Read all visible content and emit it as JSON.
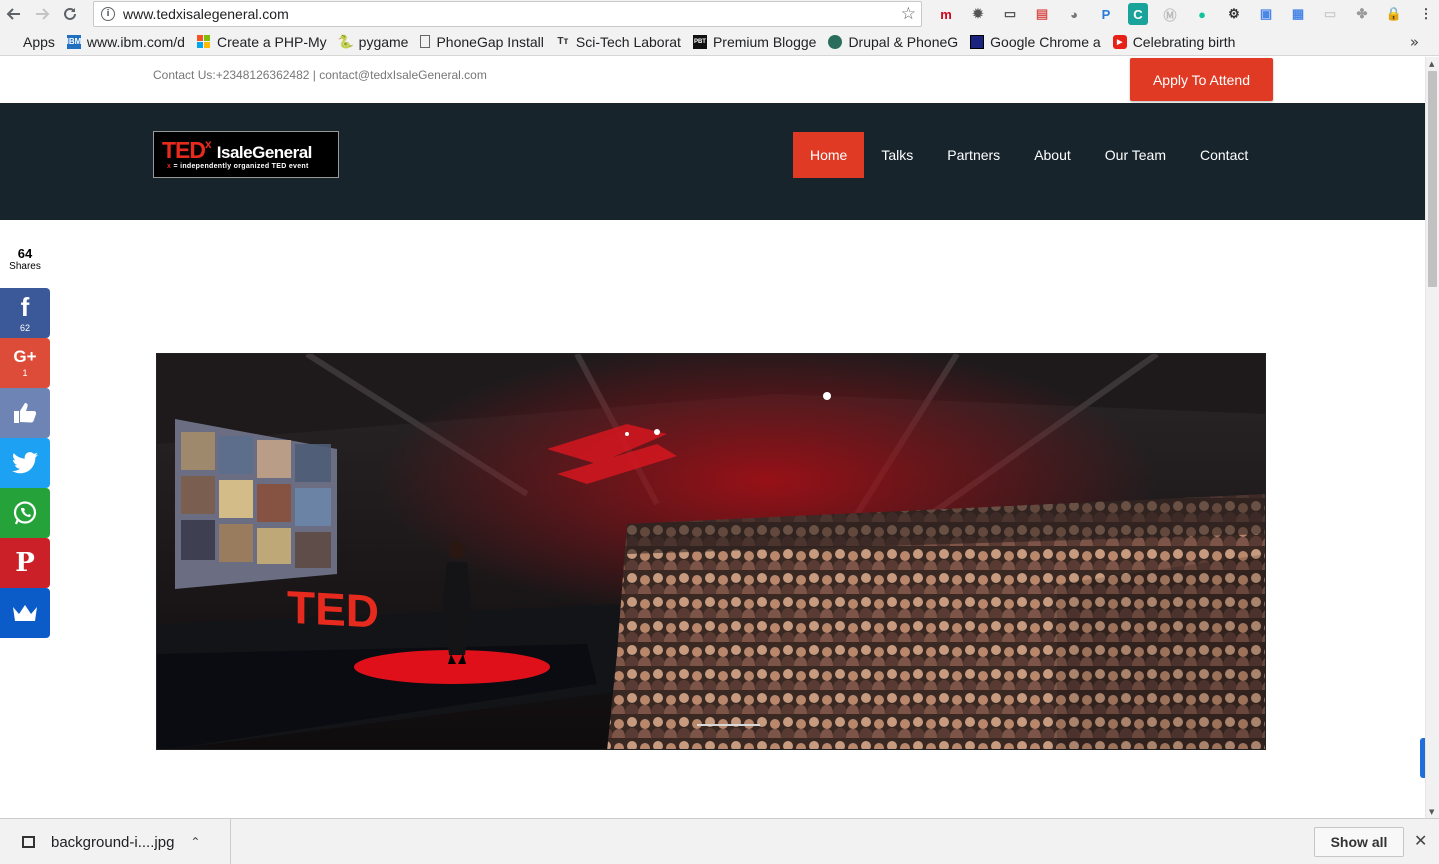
{
  "browser": {
    "url": "www.tedxisalegeneral.com",
    "bookmarks": [
      {
        "label": "Apps",
        "icon": "apps-grid-icon"
      },
      {
        "label": "www.ibm.com/d",
        "icon": "ibm-icon"
      },
      {
        "label": "Create a PHP-My",
        "icon": "windows-icon"
      },
      {
        "label": "pygame",
        "icon": "pygame-icon"
      },
      {
        "label": "PhoneGap Install",
        "icon": "page-icon"
      },
      {
        "label": "Sci-Tech Laborat",
        "icon": "tt-icon"
      },
      {
        "label": "Premium Blogge",
        "icon": "pbt-icon"
      },
      {
        "label": "Drupal & PhoneG",
        "icon": "drupal-icon"
      },
      {
        "label": "Google Chrome a",
        "icon": "book-icon"
      },
      {
        "label": "Celebrating birth",
        "icon": "youtube-icon"
      }
    ],
    "more_glyph": "»"
  },
  "site": {
    "contact_line": "Contact Us:+2348126362482 | contact@tedxIsaleGeneral.com",
    "apply_label": "Apply To Attend",
    "logo": {
      "ted": "TED",
      "x": "x",
      "name": "IsaleGeneral",
      "tag_x": "x",
      "tag": " = independently organized TED event"
    },
    "nav": [
      {
        "label": "Home",
        "active": true
      },
      {
        "label": "Talks"
      },
      {
        "label": "Partners"
      },
      {
        "label": "About"
      },
      {
        "label": "Our Team"
      },
      {
        "label": "Contact"
      }
    ]
  },
  "share": {
    "total": "64",
    "total_label": "Shares",
    "buttons": [
      {
        "name": "facebook",
        "glyph": "f",
        "count": "62",
        "color": "#3b5998"
      },
      {
        "name": "google-plus",
        "glyph": "G+",
        "count": "1",
        "color": "#dd4b39"
      },
      {
        "name": "like",
        "glyph": "👍",
        "count": "",
        "color": "#6d84b4"
      },
      {
        "name": "twitter",
        "glyph": "🐦",
        "count": "",
        "color": "#1da1f2"
      },
      {
        "name": "whatsapp",
        "glyph": "✆",
        "count": "",
        "color": "#25a33a"
      },
      {
        "name": "pinterest",
        "glyph": "P",
        "count": "",
        "color": "#cb2027"
      },
      {
        "name": "sumome",
        "glyph": "♛",
        "count": "",
        "color": "#0b5bc9"
      }
    ]
  },
  "hero": {
    "stage_logo": "TED"
  },
  "downloads": {
    "file": "background-i....jpg",
    "show_all": "Show all",
    "close": "✕"
  },
  "colors": {
    "accent": "#e03a24",
    "header_bg": "#17242c",
    "ted_red": "#e62b1e"
  }
}
